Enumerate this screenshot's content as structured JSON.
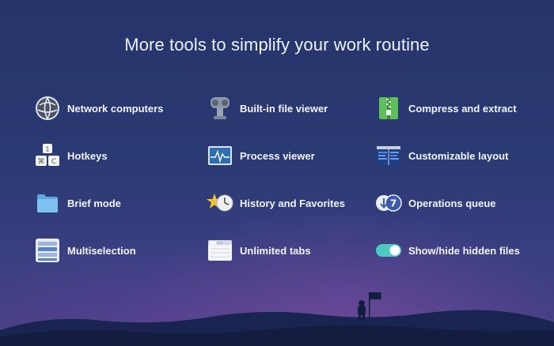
{
  "headline": "More tools to simplify your work routine",
  "features": {
    "network": {
      "label": "Network computers",
      "icon": "network-globe-icon"
    },
    "hotkeys": {
      "label": "Hotkeys",
      "icon": "keyboard-keys-icon"
    },
    "brief": {
      "label": "Brief mode",
      "icon": "folder-icon"
    },
    "multiselection": {
      "label": "Multiselection",
      "icon": "multiselection-list-icon"
    },
    "viewer": {
      "label": "Built-in file viewer",
      "icon": "binoculars-viewer-icon"
    },
    "process": {
      "label": "Process viewer",
      "icon": "activity-monitor-icon"
    },
    "history": {
      "label": "History and Favorites",
      "icon": "star-clock-icon"
    },
    "tabs": {
      "label": "Unlimited tabs",
      "icon": "tabs-window-icon"
    },
    "compress": {
      "label": "Compress and extract",
      "icon": "zip-archive-icon"
    },
    "layout": {
      "label": "Customizable layout",
      "icon": "layout-window-icon"
    },
    "queue": {
      "label": "Operations queue",
      "icon": "download-queue-icon"
    },
    "hidden": {
      "label": "Show/hide hidden files",
      "icon": "toggle-switch-icon"
    }
  },
  "queue_badge": "7",
  "colors": {
    "background": "#2a3a72",
    "accent_green": "#5ec05a",
    "toggle": "#4cc9c0"
  }
}
